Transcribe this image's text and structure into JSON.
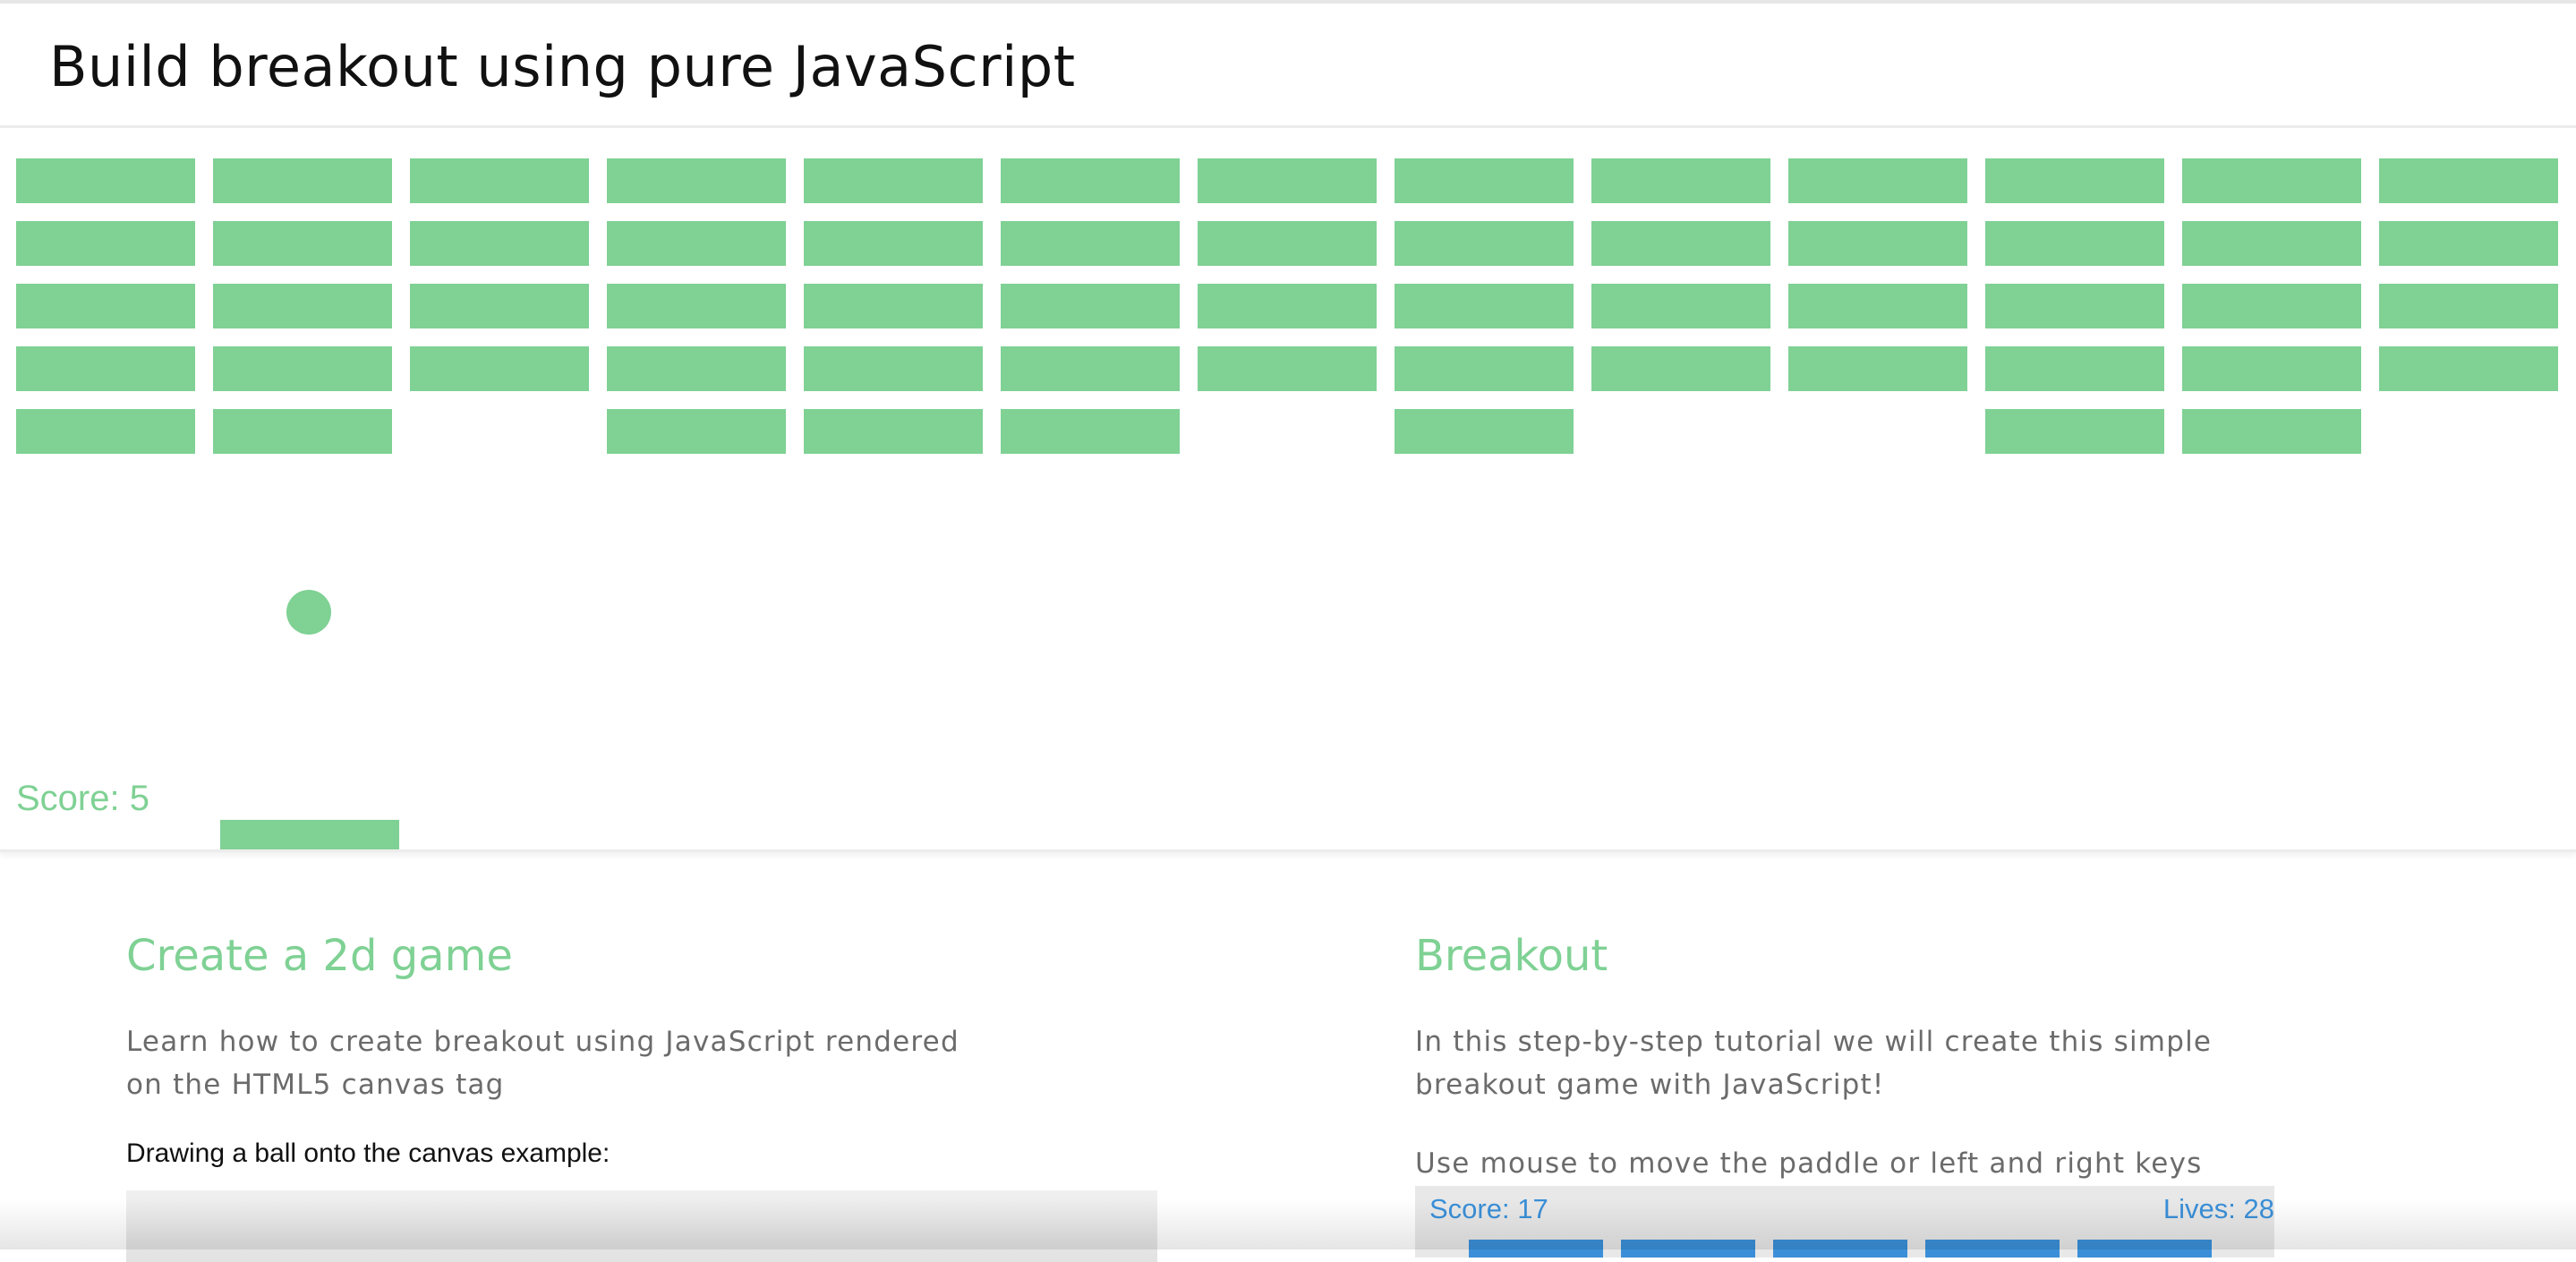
{
  "header": {
    "title": "Build breakout using pure JavaScript"
  },
  "game": {
    "score_text": "Score: 5",
    "brick_color": "#7fd194",
    "brick_rows": [
      [
        1,
        1,
        1,
        1,
        1,
        1,
        1,
        1,
        1,
        1,
        1,
        1,
        1
      ],
      [
        1,
        1,
        1,
        1,
        1,
        1,
        1,
        1,
        1,
        1,
        1,
        1,
        1
      ],
      [
        1,
        1,
        1,
        1,
        1,
        1,
        1,
        1,
        1,
        1,
        1,
        1,
        1
      ],
      [
        1,
        1,
        1,
        1,
        1,
        1,
        1,
        1,
        1,
        1,
        1,
        1,
        1
      ],
      [
        1,
        1,
        0,
        1,
        1,
        1,
        0,
        1,
        0,
        0,
        1,
        1,
        0
      ]
    ]
  },
  "left_section": {
    "heading": "Create a 2d game",
    "description": "Learn how to create breakout using JavaScript rendered on the HTML5 canvas tag",
    "example_label": "Drawing a ball onto the canvas example:"
  },
  "right_section": {
    "heading": "Breakout",
    "description": "In this step-by-step tutorial we will create this simple breakout game with JavaScript!",
    "instructions": "Use mouse to move the paddle or left and right keys",
    "preview": {
      "score_text": "Score: 17",
      "lives_text": "Lives: 28",
      "accent_color": "#3a8fd8"
    }
  }
}
